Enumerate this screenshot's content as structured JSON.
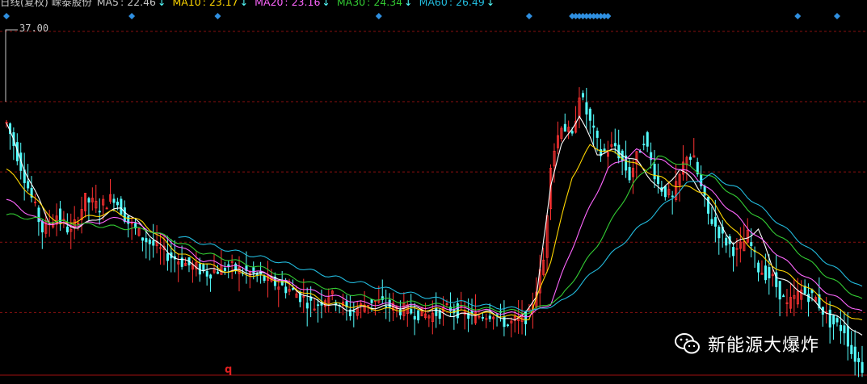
{
  "legend": {
    "title": "日线(复权) 嵘泰股份",
    "items": [
      {
        "name": "MA5",
        "value": "22.46",
        "arrow": "↓",
        "color": "#ffffff"
      },
      {
        "name": "MA10",
        "value": "23.17",
        "arrow": "↓",
        "color": "#ffd700"
      },
      {
        "name": "MA20",
        "value": "23.16",
        "arrow": "↓",
        "color": "#ff66ff"
      },
      {
        "name": "MA30",
        "value": "24.34",
        "arrow": "↓",
        "color": "#33cc33"
      },
      {
        "name": "MA60",
        "value": "26.49",
        "arrow": "↓",
        "color": "#22bbdd"
      }
    ]
  },
  "price_marker": "37.00",
  "x_marker": "q",
  "watermark": {
    "text": "新能源大爆炸",
    "icon": "wechat-icon"
  },
  "colors": {
    "up": "#ff3232",
    "down": "#54ffff",
    "grid": "#8a1010",
    "diamond": "#2f8fe0"
  },
  "chart_data": {
    "type": "line",
    "title": "日线(复权) 嵘泰股份",
    "y_reference": 37.0,
    "ylim": [
      14.5,
      38.0
    ],
    "x_count": 240,
    "series": [
      {
        "name": "MA5",
        "color": "#ffffff",
        "keyframes": [
          [
            0,
            31.0
          ],
          [
            5,
            28.0
          ],
          [
            12,
            24.5
          ],
          [
            20,
            24.2
          ],
          [
            26,
            24.8
          ],
          [
            32,
            25.5
          ],
          [
            38,
            24.2
          ],
          [
            45,
            22.5
          ],
          [
            55,
            21.4
          ],
          [
            65,
            21.3
          ],
          [
            75,
            21.0
          ],
          [
            85,
            19.5
          ],
          [
            95,
            18.8
          ],
          [
            105,
            19.0
          ],
          [
            115,
            18.9
          ],
          [
            125,
            18.4
          ],
          [
            135,
            18.6
          ],
          [
            142,
            18.0
          ],
          [
            148,
            19.5
          ],
          [
            152,
            27.0
          ],
          [
            155,
            29.5
          ],
          [
            160,
            31.5
          ],
          [
            165,
            29.0
          ],
          [
            170,
            29.2
          ],
          [
            176,
            28.5
          ],
          [
            183,
            26.5
          ],
          [
            188,
            28.0
          ],
          [
            192,
            27.2
          ],
          [
            197,
            25.5
          ],
          [
            203,
            23.0
          ],
          [
            210,
            24.0
          ],
          [
            215,
            21.0
          ],
          [
            222,
            20.0
          ],
          [
            228,
            18.8
          ],
          [
            234,
            18.0
          ],
          [
            239,
            17.0
          ]
        ]
      },
      {
        "name": "MA10",
        "color": "#ffd700",
        "keyframes": [
          [
            0,
            28.0
          ],
          [
            8,
            26.0
          ],
          [
            15,
            24.3
          ],
          [
            22,
            24.8
          ],
          [
            30,
            25.2
          ],
          [
            38,
            24.5
          ],
          [
            48,
            22.5
          ],
          [
            60,
            21.4
          ],
          [
            75,
            20.8
          ],
          [
            90,
            19.2
          ],
          [
            105,
            18.8
          ],
          [
            120,
            18.8
          ],
          [
            135,
            18.5
          ],
          [
            146,
            18.2
          ],
          [
            152,
            22.0
          ],
          [
            158,
            27.5
          ],
          [
            163,
            29.5
          ],
          [
            170,
            29.0
          ],
          [
            178,
            28.0
          ],
          [
            186,
            27.0
          ],
          [
            195,
            26.5
          ],
          [
            203,
            24.0
          ],
          [
            212,
            22.0
          ],
          [
            222,
            20.5
          ],
          [
            232,
            18.8
          ],
          [
            239,
            18.0
          ]
        ]
      },
      {
        "name": "MA20",
        "color": "#ff66ff",
        "keyframes": [
          [
            0,
            26.0
          ],
          [
            10,
            24.5
          ],
          [
            20,
            24.3
          ],
          [
            32,
            24.8
          ],
          [
            42,
            23.8
          ],
          [
            55,
            22.0
          ],
          [
            70,
            21.3
          ],
          [
            85,
            20.0
          ],
          [
            100,
            19.2
          ],
          [
            115,
            19.0
          ],
          [
            130,
            18.8
          ],
          [
            146,
            18.4
          ],
          [
            152,
            19.2
          ],
          [
            160,
            24.0
          ],
          [
            168,
            28.0
          ],
          [
            176,
            29.2
          ],
          [
            184,
            28.4
          ],
          [
            192,
            27.6
          ],
          [
            200,
            25.8
          ],
          [
            210,
            23.5
          ],
          [
            220,
            21.5
          ],
          [
            230,
            19.8
          ],
          [
            239,
            18.6
          ]
        ]
      },
      {
        "name": "MA30",
        "color": "#33cc33",
        "keyframes": [
          [
            0,
            25.0
          ],
          [
            12,
            24.6
          ],
          [
            25,
            24.3
          ],
          [
            40,
            24.0
          ],
          [
            55,
            22.5
          ],
          [
            70,
            21.6
          ],
          [
            85,
            20.5
          ],
          [
            100,
            19.6
          ],
          [
            115,
            19.2
          ],
          [
            130,
            18.9
          ],
          [
            146,
            18.6
          ],
          [
            155,
            19.6
          ],
          [
            165,
            23.0
          ],
          [
            175,
            27.0
          ],
          [
            182,
            28.8
          ],
          [
            190,
            28.2
          ],
          [
            198,
            27.3
          ],
          [
            208,
            25.2
          ],
          [
            218,
            23.2
          ],
          [
            228,
            21.2
          ],
          [
            239,
            19.4
          ]
        ]
      },
      {
        "name": "MA60",
        "color": "#22bbdd",
        "keyframes": [
          [
            48,
            23.6
          ],
          [
            60,
            22.8
          ],
          [
            75,
            22.0
          ],
          [
            90,
            21.0
          ],
          [
            105,
            20.2
          ],
          [
            120,
            19.5
          ],
          [
            135,
            19.0
          ],
          [
            148,
            18.7
          ],
          [
            156,
            19.4
          ],
          [
            165,
            21.5
          ],
          [
            175,
            23.8
          ],
          [
            183,
            25.5
          ],
          [
            190,
            27.0
          ],
          [
            197,
            27.6
          ],
          [
            205,
            26.6
          ],
          [
            215,
            24.6
          ],
          [
            225,
            22.6
          ],
          [
            239,
            20.2
          ]
        ]
      }
    ],
    "price_path": [
      [
        0,
        31.0
      ],
      [
        5,
        27.5
      ],
      [
        10,
        24.0
      ],
      [
        14,
        25.0
      ],
      [
        18,
        23.8
      ],
      [
        22,
        26.0
      ],
      [
        26,
        25.5
      ],
      [
        30,
        26.2
      ],
      [
        34,
        24.5
      ],
      [
        38,
        23.5
      ],
      [
        44,
        22.5
      ],
      [
        50,
        21.8
      ],
      [
        56,
        21.2
      ],
      [
        62,
        21.6
      ],
      [
        70,
        21.0
      ],
      [
        80,
        20.0
      ],
      [
        86,
        19.0
      ],
      [
        90,
        19.8
      ],
      [
        96,
        18.6
      ],
      [
        102,
        19.4
      ],
      [
        110,
        18.8
      ],
      [
        118,
        18.4
      ],
      [
        124,
        18.9
      ],
      [
        130,
        18.3
      ],
      [
        136,
        18.6
      ],
      [
        140,
        17.8
      ],
      [
        146,
        18.4
      ],
      [
        150,
        22.0
      ],
      [
        152,
        28.5
      ],
      [
        155,
        31.0
      ],
      [
        158,
        30.0
      ],
      [
        160,
        33.0
      ],
      [
        163,
        31.0
      ],
      [
        166,
        29.0
      ],
      [
        170,
        29.5
      ],
      [
        174,
        27.5
      ],
      [
        178,
        30.0
      ],
      [
        182,
        27.0
      ],
      [
        186,
        26.0
      ],
      [
        190,
        29.0
      ],
      [
        192,
        28.5
      ],
      [
        196,
        25.0
      ],
      [
        200,
        23.5
      ],
      [
        204,
        22.5
      ],
      [
        207,
        23.6
      ],
      [
        210,
        21.5
      ],
      [
        214,
        20.8
      ],
      [
        218,
        19.0
      ],
      [
        222,
        20.0
      ],
      [
        226,
        19.5
      ],
      [
        230,
        18.0
      ],
      [
        234,
        17.5
      ],
      [
        236,
        16.0
      ],
      [
        239,
        15.0
      ]
    ],
    "diamonds_x_index": [
      0,
      35,
      59,
      104,
      146,
      158,
      159,
      160,
      161,
      162,
      163,
      164,
      165,
      166,
      167,
      168,
      221,
      232
    ]
  }
}
